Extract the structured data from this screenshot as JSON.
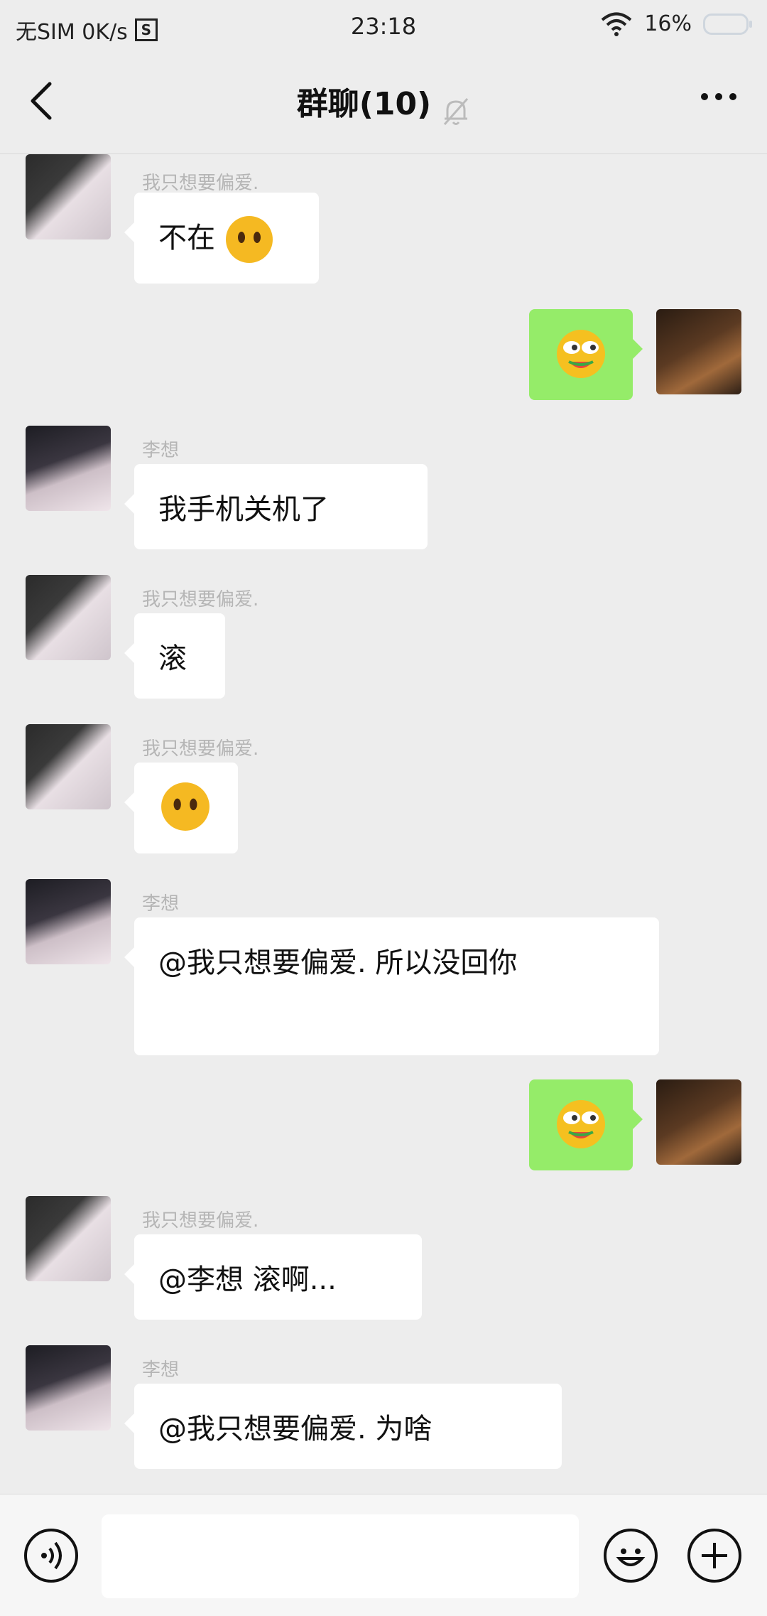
{
  "status_bar": {
    "carrier": "无SIM 0K/s",
    "carrier_icon": "S",
    "time": "23:18",
    "battery": "16%",
    "wifi_icon": "wifi-icon",
    "battery_icon": "battery-icon"
  },
  "header": {
    "title": "群聊(10)",
    "back_icon": "back-arrow-icon",
    "mute_icon": "bell-muted-icon",
    "more_icon": "more-icon"
  },
  "messages": [
    {
      "sender": "我只想要偏爱.",
      "text": "不在",
      "emoji": "neutral-face"
    },
    {
      "sender": "me",
      "text": "",
      "emoji": "melon-face"
    },
    {
      "sender": "李想",
      "text": "我手机关机了"
    },
    {
      "sender": "我只想要偏爱.",
      "text": "滚"
    },
    {
      "sender": "我只想要偏爱.",
      "text": "",
      "emoji": "neutral-face"
    },
    {
      "sender": "李想",
      "text": "@我只想要偏爱. 所以没回你"
    },
    {
      "sender": "me",
      "text": "",
      "emoji": "melon-face"
    },
    {
      "sender": "我只想要偏爱.",
      "text": "@李想 滚啊..."
    },
    {
      "sender": "李想",
      "text": "@我只想要偏爱. 为啥"
    }
  ],
  "input_bar": {
    "voice_icon": "voice-icon",
    "emoji_icon": "emoji-icon",
    "add_icon": "add-icon",
    "placeholder": ""
  },
  "colors": {
    "background": "#ededed",
    "my_bubble": "#95ec69",
    "other_bubble": "#ffffff"
  }
}
